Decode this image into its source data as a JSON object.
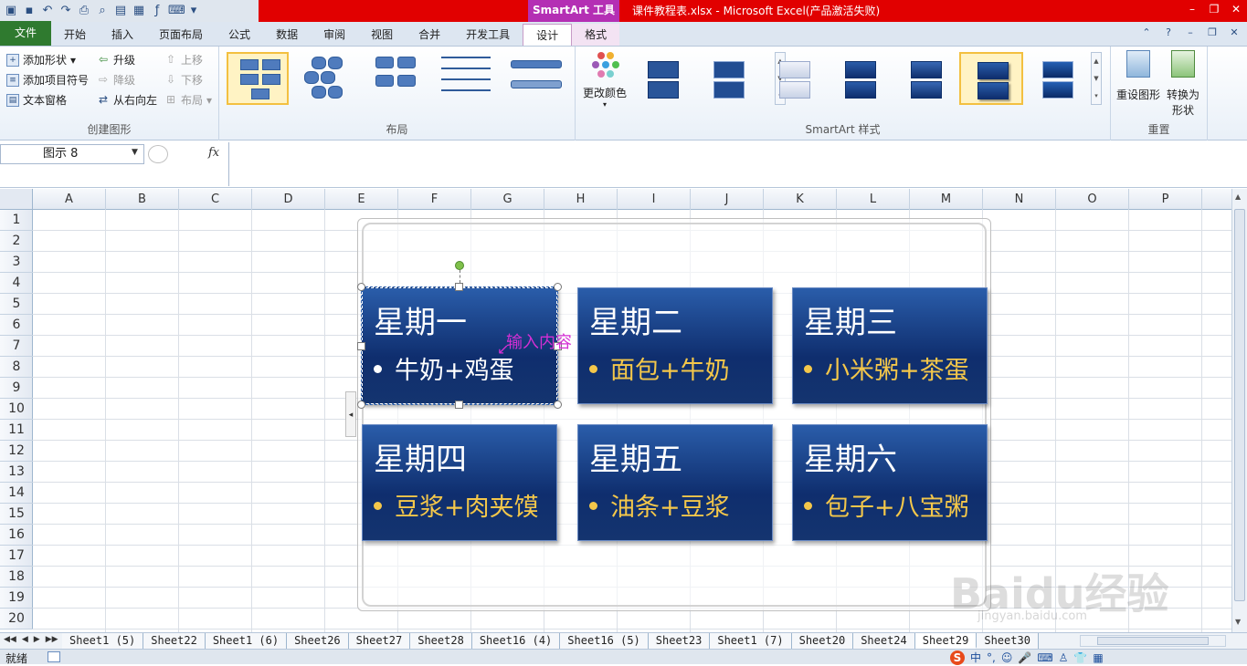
{
  "window": {
    "context_tab": "SmartArt 工具",
    "title": "课件教程表.xlsx - Microsoft Excel(产品激活失败)"
  },
  "ribbon_tabs": [
    {
      "label": "文件"
    },
    {
      "label": "开始"
    },
    {
      "label": "插入"
    },
    {
      "label": "页面布局"
    },
    {
      "label": "公式"
    },
    {
      "label": "数据"
    },
    {
      "label": "审阅"
    },
    {
      "label": "视图"
    },
    {
      "label": "合并"
    },
    {
      "label": "开发工具"
    },
    {
      "label": "设计"
    },
    {
      "label": "格式"
    }
  ],
  "ribbon": {
    "create_group": {
      "label": "创建图形",
      "add_shape": "添加形状",
      "add_bullet": "添加项目符号",
      "text_pane": "文本窗格",
      "promote": "升级",
      "demote": "降级",
      "rtl": "从右向左",
      "move_up": "上移",
      "move_down": "下移",
      "layout": "布局"
    },
    "layout_group": {
      "label": "布局"
    },
    "color_group": {
      "change_colors": "更改颜色"
    },
    "style_group": {
      "label": "SmartArt 样式"
    },
    "reset_group": {
      "label": "重置",
      "reset_graphic": "重设图形",
      "convert": "转换为",
      "convert2": "形状"
    }
  },
  "formula_bar": {
    "name_box": "图示 8",
    "fx": "fx"
  },
  "columns": [
    "A",
    "B",
    "C",
    "D",
    "E",
    "F",
    "G",
    "H",
    "I",
    "J",
    "K",
    "L",
    "M",
    "N",
    "O",
    "P"
  ],
  "rows": [
    "1",
    "2",
    "3",
    "4",
    "5",
    "6",
    "7",
    "8",
    "9",
    "10",
    "11",
    "12",
    "13",
    "14",
    "15",
    "16",
    "17",
    "18",
    "19",
    "20"
  ],
  "smartart": {
    "cards": [
      {
        "title": "星期一",
        "item": "牛奶+鸡蛋"
      },
      {
        "title": "星期二",
        "item": "面包+牛奶"
      },
      {
        "title": "星期三",
        "item": "小米粥+茶蛋"
      },
      {
        "title": "星期四",
        "item": "豆浆+肉夹馍"
      },
      {
        "title": "星期五",
        "item": "油条+豆浆"
      },
      {
        "title": "星期六",
        "item": "包子+八宝粥"
      }
    ],
    "annotation": "输入内容"
  },
  "sheet_tabs": [
    "Sheet1 (5)",
    "Sheet22",
    "Sheet1 (6)",
    "Sheet26",
    "Sheet27",
    "Sheet28",
    "Sheet16 (4)",
    "Sheet16 (5)",
    "Sheet23",
    "Sheet1 (7)",
    "Sheet20",
    "Sheet24",
    "Sheet29",
    "Sheet30"
  ],
  "active_sheet": "Sheet29",
  "status": {
    "ready": "就绪",
    "ime": "中"
  },
  "watermark": {
    "brand": "Baidu经验",
    "url": "jingyan.baidu.com"
  },
  "colors": {
    "title_bar": "#e10000",
    "context_tab": "#b42fb4",
    "card_dark": "#0f2e6e",
    "bullet_gold": "#f4c74a",
    "annotation": "#d42fd4"
  }
}
